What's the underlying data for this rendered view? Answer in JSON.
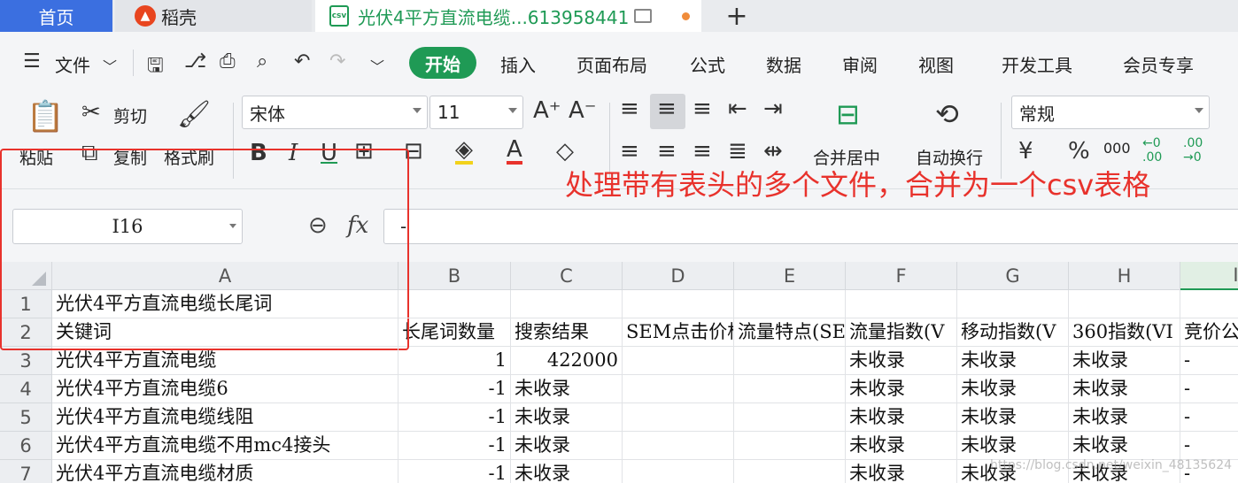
{
  "tabs": {
    "home": "首页",
    "daoke": "稻壳",
    "active_file": "光伏4平方直流电缆...613958441",
    "add": "+"
  },
  "menu": {
    "file": "文件",
    "start": "开始",
    "items": [
      "插入",
      "页面布局",
      "公式",
      "数据",
      "审阅",
      "视图",
      "开发工具",
      "会员专享"
    ]
  },
  "ribbon": {
    "paste": "粘贴",
    "cut": "剪切",
    "copy": "复制",
    "format_painter": "格式刷",
    "font_name": "宋体",
    "font_size": "11",
    "merge_center": "合并居中",
    "auto_wrap": "自动换行",
    "number_format": "常规",
    "percent": "%",
    "thousands": "000",
    "decimal_inc": "←0 .00",
    "decimal_dec": ".00 →0",
    "bold": "B",
    "italic": "I",
    "underline": "U",
    "font_color": "A",
    "currency": "¥"
  },
  "formula_bar": {
    "cell_ref": "I16",
    "fx": "fx",
    "content": "-"
  },
  "grid": {
    "columns": [
      "A",
      "B",
      "C",
      "D",
      "E",
      "F",
      "G",
      "H",
      "I"
    ],
    "selected_column": "I",
    "rows": [
      {
        "n": "1",
        "cells": [
          "光伏4平方直流电缆长尾词",
          "",
          "",
          "",
          "",
          "",
          "",
          "",
          ""
        ]
      },
      {
        "n": "2",
        "cells": [
          "关键词",
          "长尾词数量",
          "搜索结果",
          "SEM点击价格",
          "流量特点(SEO)",
          "流量指数(V",
          "移动指数(V",
          "360指数(VI",
          "竞价公"
        ]
      },
      {
        "n": "3",
        "cells": [
          "光伏4平方直流电缆",
          "1",
          "422000",
          "",
          "",
          "未收录",
          "未收录",
          "未收录",
          "-"
        ]
      },
      {
        "n": "4",
        "cells": [
          "光伏4平方直流电缆6",
          "-1",
          "未收录",
          "",
          "",
          "未收录",
          "未收录",
          "未收录",
          "-"
        ]
      },
      {
        "n": "5",
        "cells": [
          "光伏4平方直流电缆线阻",
          "-1",
          "未收录",
          "",
          "",
          "未收录",
          "未收录",
          "未收录",
          "-"
        ]
      },
      {
        "n": "6",
        "cells": [
          "光伏4平方直流电缆不用mc4接头",
          "-1",
          "未收录",
          "",
          "",
          "未收录",
          "未收录",
          "未收录",
          "-"
        ]
      },
      {
        "n": "7",
        "cells": [
          "光伏4平方直流电缆材质",
          "-1",
          "未收录",
          "",
          "",
          "未收录",
          "未收录",
          "未收录",
          "-"
        ]
      }
    ]
  },
  "annotation": {
    "caption": "处理带有表头的多个文件，合并为一个csv表格",
    "color": "#e8322c"
  },
  "watermark": "https://blog.csdn.net/weixin_48135624",
  "colors": {
    "accent_green": "#1f9a55",
    "home_tab_blue": "#3b6fe0"
  }
}
